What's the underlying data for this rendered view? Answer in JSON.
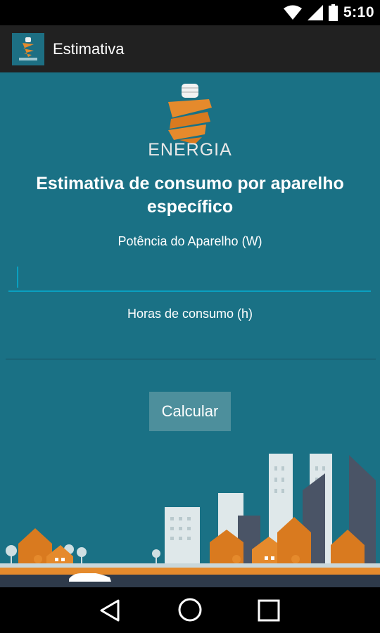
{
  "status_bar": {
    "time": "5:10"
  },
  "app_bar": {
    "title": "Estimativa"
  },
  "brand": {
    "name": "ENERGIA"
  },
  "main": {
    "heading": "Estimativa de consumo por aparelho específico",
    "power_field": {
      "label": "Potência do Aparelho (W)",
      "value": ""
    },
    "hours_field": {
      "label": "Horas de consumo (h)",
      "value": ""
    },
    "calculate_button": "Calcular"
  },
  "colors": {
    "background": "#1a7185",
    "accent": "#0aa0c0",
    "brand_orange": "#e58a2c"
  },
  "icons": [
    "wifi-icon",
    "signal-icon",
    "battery-icon",
    "back-icon",
    "home-icon",
    "recents-icon"
  ]
}
